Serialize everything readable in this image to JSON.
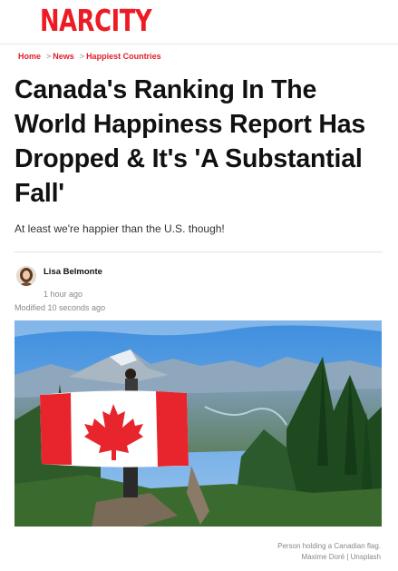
{
  "site": {
    "logo": "NARCITY"
  },
  "breadcrumb": {
    "home": "Home",
    "news": "News",
    "category": "Happiest Countries",
    "separator": ">"
  },
  "article": {
    "title": "Canada's Ranking In The World Happiness Report Has Dropped & It's 'A Substantial Fall'",
    "subtitle": "At least we're happier than the U.S. though!",
    "author": "Lisa Belmonte",
    "published": "1 hour ago",
    "modified": "Modified 10 seconds ago"
  },
  "image": {
    "caption": "Person holding a Canadian flag.",
    "credit": "Maxime Doré | Unsplash"
  },
  "colors": {
    "brand": "#ed1c24",
    "flag_red": "#e8242c",
    "text": "#111111",
    "muted": "#888888"
  },
  "icons": {
    "avatar": "author-avatar"
  }
}
